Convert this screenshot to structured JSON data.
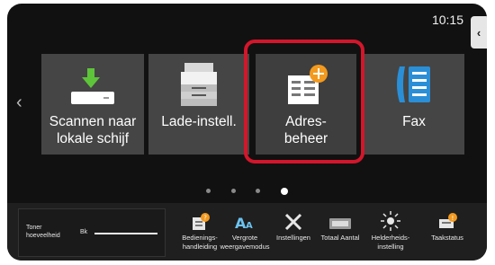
{
  "status": {
    "time": "10:15"
  },
  "tiles": [
    {
      "label_line1": "Scannen naar",
      "label_line2": "lokale schijf",
      "icon": "scan-to-local-drive-icon"
    },
    {
      "label_line1": "Lade-instell.",
      "label_line2": "",
      "icon": "printer-tray-icon"
    },
    {
      "label_line1": "Adres-",
      "label_line2": "beheer",
      "icon": "address-book-add-icon"
    },
    {
      "label_line1": "Fax",
      "label_line2": "",
      "icon": "fax-icon"
    }
  ],
  "pager": {
    "count": 4,
    "active_index": 3
  },
  "toner": {
    "label_line1": "Toner",
    "label_line2": "hoeveelheid",
    "color_code": "Bk"
  },
  "shortcuts": [
    {
      "line1": "Bedienings-",
      "line2": "handleiding",
      "icon": "manual-icon"
    },
    {
      "line1": "Vergrote",
      "line2": "weergavemodus",
      "icon": "enlarge-text-icon"
    },
    {
      "line1": "Instellingen",
      "line2": "",
      "icon": "tools-icon"
    },
    {
      "line1": "Totaal Aantal",
      "line2": "",
      "icon": "counter-icon"
    },
    {
      "line1": "Helderheids-",
      "line2": "instelling",
      "icon": "brightness-icon"
    },
    {
      "line1": "Taakstatus",
      "line2": "",
      "icon": "job-status-icon"
    }
  ],
  "colors": {
    "highlight": "#d3162b",
    "accent_orange": "#f39a1e",
    "fax_blue": "#2a8fd6"
  }
}
